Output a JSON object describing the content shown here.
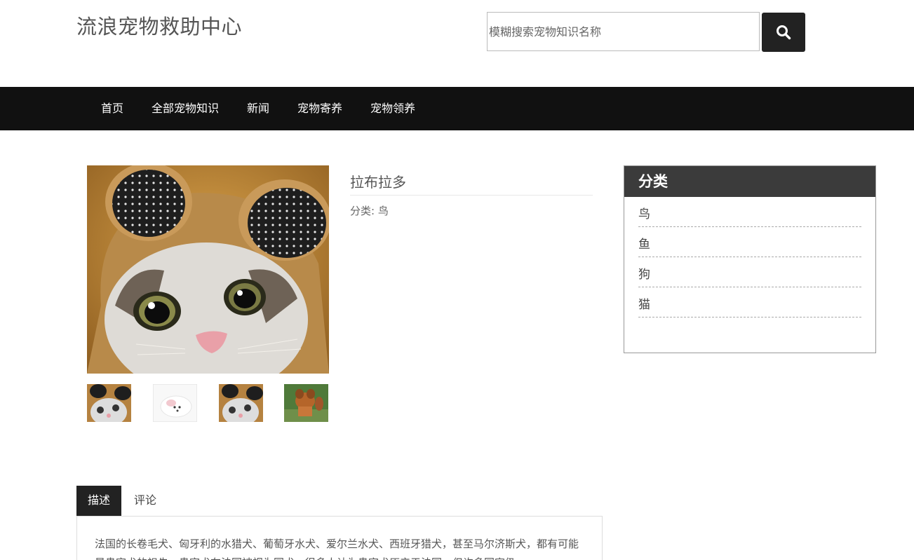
{
  "header": {
    "site_title": "流浪宠物救助中心",
    "search_placeholder": "模糊搜索宠物知识名称"
  },
  "nav": {
    "items": [
      "首页",
      "全部宠物知识",
      "新闻",
      "宠物寄养",
      "宠物领养"
    ]
  },
  "pet": {
    "name": "拉布拉多",
    "category_label": "分类: 鸟"
  },
  "sidebar": {
    "title": "分类",
    "categories": [
      "鸟",
      "鱼",
      "狗",
      "猫"
    ]
  },
  "tabs": {
    "description": "描述",
    "comments": "评论"
  },
  "description": {
    "text": "法国的长卷毛犬、匈牙利的水猎犬、葡萄牙水犬、爱尔兰水犬、西班牙猎犬，甚至马尔济斯犬，都有可能是贵宾犬的祖先。贵宾犬在法国被视为国犬，很多人认为贵宾犬原产于法国，但许多国家仍"
  },
  "colors": {
    "navbar_bg": "#111111",
    "sidebar_header_bg": "#3b3b3b",
    "active_tab_bg": "#222222",
    "search_button_bg": "#222222"
  }
}
